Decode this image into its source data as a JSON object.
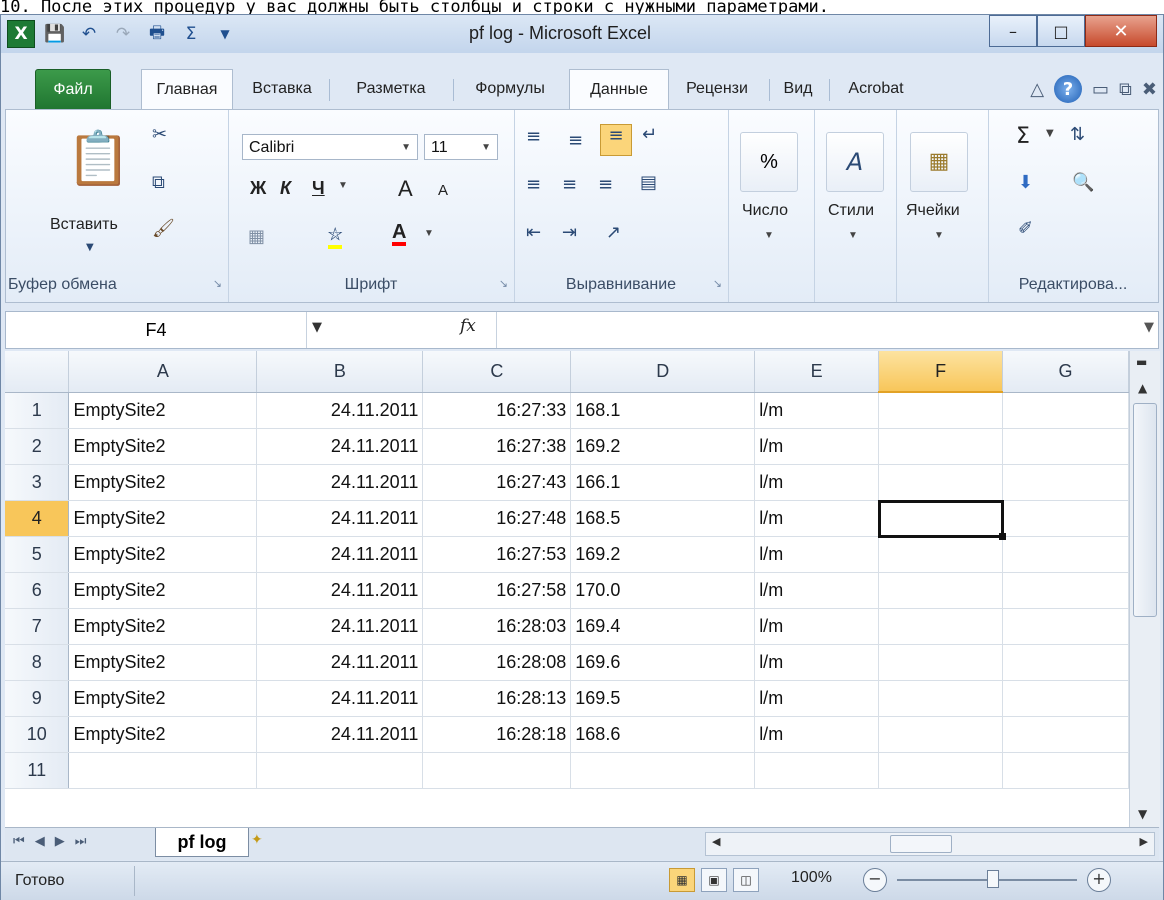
{
  "caption": "10. После этих процедур у вас должны быть столбцы и строки с нужными параметрами.",
  "window": {
    "title": "pf log - Microsoft Excel",
    "qat": {
      "logo": "X",
      "sigma": "Σ"
    }
  },
  "tabs": [
    "Файл",
    "Главная",
    "Вставка",
    "Разметка",
    "Формулы",
    "Данные",
    "Рецензи",
    "Вид",
    "Acrobat"
  ],
  "ribbon": {
    "clipboard": {
      "paste": "Вставить",
      "label": "Буфер обмена"
    },
    "font": {
      "name": "Calibri",
      "size": "11",
      "bold": "Ж",
      "italic": "К",
      "underline": "Ч",
      "grow": "A",
      "shrink": "A",
      "label": "Шрифт"
    },
    "alignment": {
      "label": "Выравнивание"
    },
    "number": {
      "symbol": "%",
      "label": "Число"
    },
    "styles": {
      "label": "Стили"
    },
    "cells": {
      "label": "Ячейки"
    },
    "editing": {
      "label": "Редактирова..."
    }
  },
  "formula_bar": {
    "name_box": "F4",
    "fx": "fx",
    "value": ""
  },
  "grid": {
    "columns": [
      "A",
      "B",
      "C",
      "D",
      "E",
      "F",
      "G"
    ],
    "selected_column": "F",
    "selected_row": 4,
    "rows": [
      {
        "n": "1",
        "a": "EmptySite2",
        "b": "24.11.2011",
        "c": "16:27:33",
        "d": "168.1",
        "e": "l/m"
      },
      {
        "n": "2",
        "a": "EmptySite2",
        "b": "24.11.2011",
        "c": "16:27:38",
        "d": "169.2",
        "e": "l/m"
      },
      {
        "n": "3",
        "a": "EmptySite2",
        "b": "24.11.2011",
        "c": "16:27:43",
        "d": "166.1",
        "e": "l/m"
      },
      {
        "n": "4",
        "a": "EmptySite2",
        "b": "24.11.2011",
        "c": "16:27:48",
        "d": "168.5",
        "e": "l/m"
      },
      {
        "n": "5",
        "a": "EmptySite2",
        "b": "24.11.2011",
        "c": "16:27:53",
        "d": "169.2",
        "e": "l/m"
      },
      {
        "n": "6",
        "a": "EmptySite2",
        "b": "24.11.2011",
        "c": "16:27:58",
        "d": "170.0",
        "e": "l/m"
      },
      {
        "n": "7",
        "a": "EmptySite2",
        "b": "24.11.2011",
        "c": "16:28:03",
        "d": "169.4",
        "e": "l/m"
      },
      {
        "n": "8",
        "a": "EmptySite2",
        "b": "24.11.2011",
        "c": "16:28:08",
        "d": "169.6",
        "e": "l/m"
      },
      {
        "n": "9",
        "a": "EmptySite2",
        "b": "24.11.2011",
        "c": "16:28:13",
        "d": "169.5",
        "e": "l/m"
      },
      {
        "n": "10",
        "a": "EmptySite2",
        "b": "24.11.2011",
        "c": "16:28:18",
        "d": "168.6",
        "e": "l/m"
      },
      {
        "n": "11",
        "a": "",
        "b": "",
        "c": "",
        "d": "",
        "e": ""
      }
    ]
  },
  "sheet_tabs": [
    "pf log"
  ],
  "status": {
    "ready": "Готово",
    "zoom": "100%"
  },
  "colors": {
    "file_tab": "#1f7530",
    "selected_header": "#f8c65a",
    "accent": "#2b579a"
  }
}
